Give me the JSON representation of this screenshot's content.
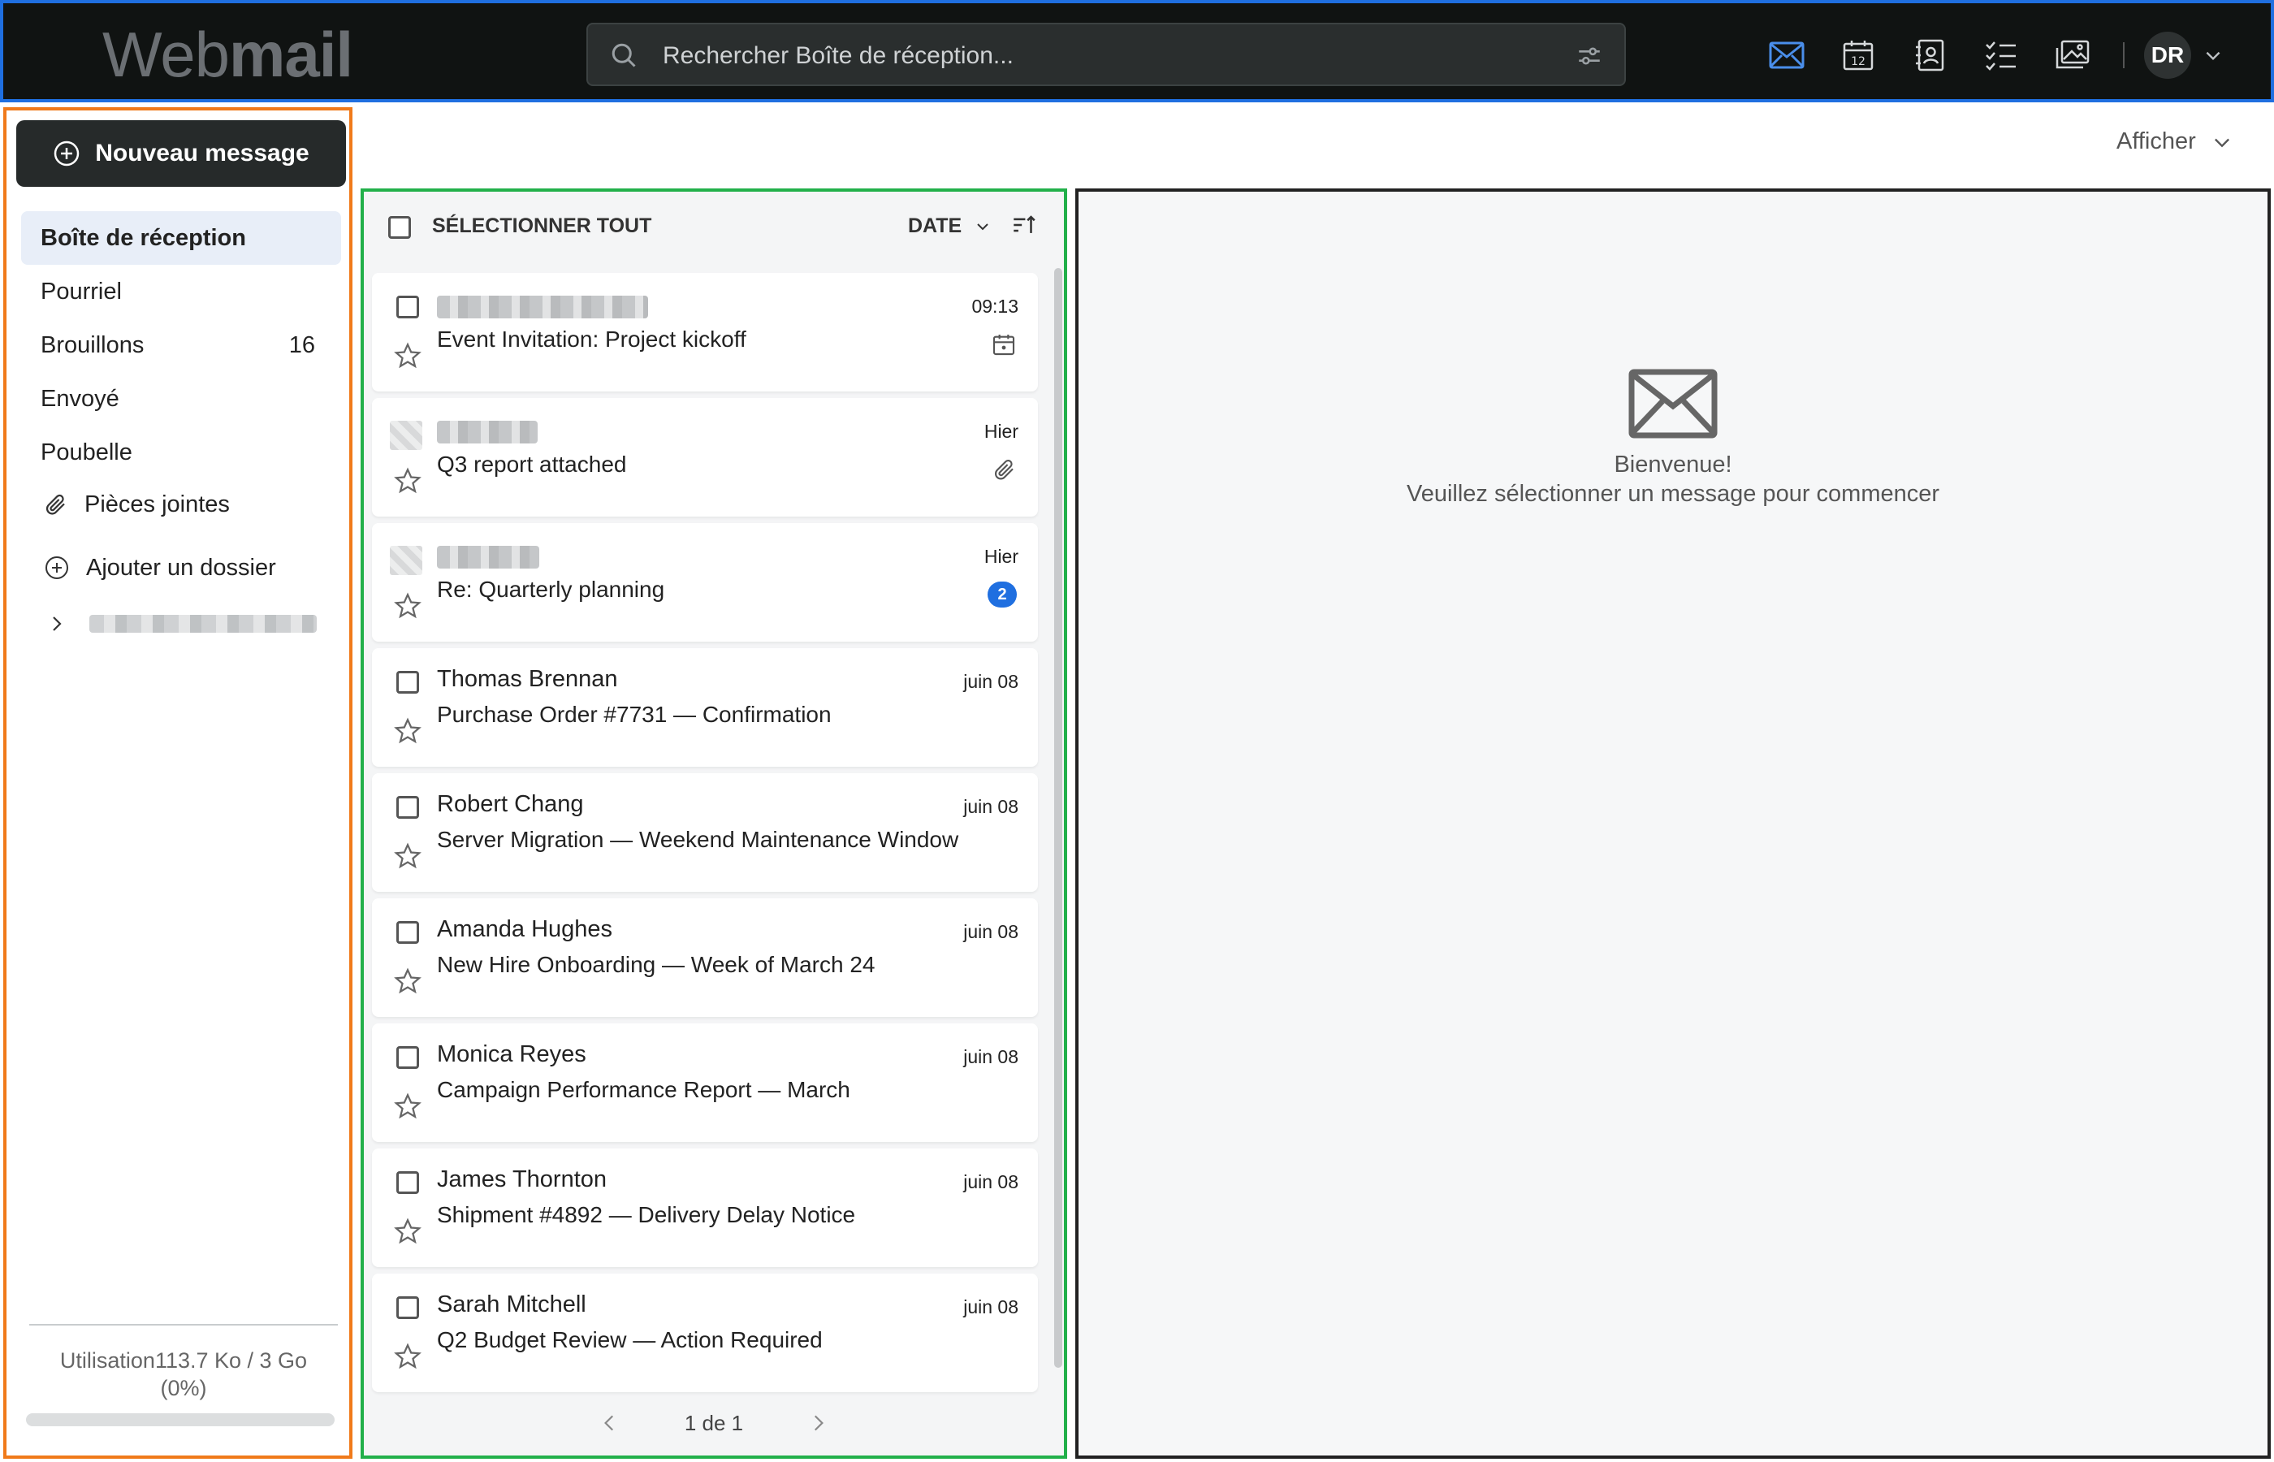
{
  "header": {
    "logo_light": "Web",
    "logo_bold": "mail",
    "search_placeholder": "Rechercher Boîte de réception...",
    "user_initials": "DR",
    "accent_color": "#1f6fe0"
  },
  "sidebar": {
    "new_message": "Nouveau message",
    "folders": [
      {
        "label": "Boîte de réception",
        "count": "",
        "active": true
      },
      {
        "label": "Pourriel",
        "count": ""
      },
      {
        "label": "Brouillons",
        "count": "16"
      },
      {
        "label": "Envoyé",
        "count": ""
      },
      {
        "label": "Poubelle",
        "count": ""
      }
    ],
    "attachments": "Pièces jointes",
    "add_folder": "Ajouter un dossier",
    "usage_label": "Utilisation113.7 Ko / 3 Go",
    "usage_percent": "(0%)",
    "usage_fraction": 0
  },
  "view_menu": "Afficher",
  "list": {
    "select_all": "SÉLECTIONNER TOUT",
    "sort_label": "DATE",
    "pager_text": "1 de 1",
    "messages": [
      {
        "sender": "",
        "subject": "Event Invitation: Project kickoff",
        "time": "09:13",
        "icon": "calendar-icon"
      },
      {
        "sender": "",
        "subject": "Q3 report attached",
        "time": "Hier",
        "icon": "paperclip-icon"
      },
      {
        "sender": "",
        "subject": "Re: Quarterly planning",
        "time": "Hier",
        "badge": "2"
      },
      {
        "sender": "Thomas Brennan",
        "subject": "Purchase Order #7731 — Confirmation",
        "time": "juin 08"
      },
      {
        "sender": "Robert Chang",
        "subject": "Server Migration — Weekend Maintenance Window",
        "time": "juin 08"
      },
      {
        "sender": "Amanda Hughes",
        "subject": "New Hire Onboarding — Week of March 24",
        "time": "juin 08"
      },
      {
        "sender": "Monica Reyes",
        "subject": "Campaign Performance Report — March",
        "time": "juin 08"
      },
      {
        "sender": "James Thornton",
        "subject": "Shipment #4892 — Delivery Delay Notice",
        "time": "juin 08"
      },
      {
        "sender": "Sarah Mitchell",
        "subject": "Q2 Budget Review — Action Required",
        "time": "juin 08"
      }
    ]
  },
  "reading": {
    "welcome_title": "Bienvenue!",
    "welcome_text": "Veuillez sélectionner un message pour commencer"
  }
}
